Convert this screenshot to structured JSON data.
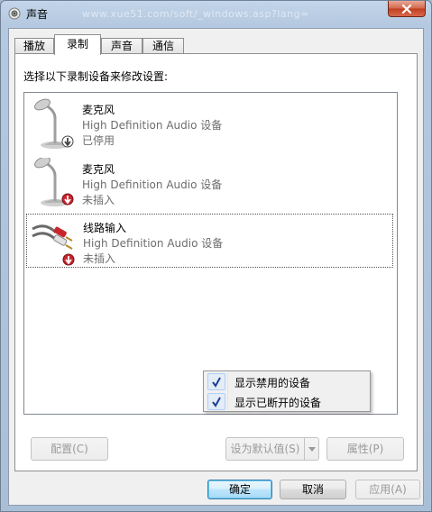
{
  "window": {
    "title": "声音",
    "watermark": "www.xue51.com/soft/_windows.asp?lang="
  },
  "tabs": [
    {
      "label": "播放",
      "active": false
    },
    {
      "label": "录制",
      "active": true
    },
    {
      "label": "声音",
      "active": false
    },
    {
      "label": "通信",
      "active": false
    }
  ],
  "instruction": "选择以下录制设备来修改设置:",
  "devices": [
    {
      "name": "麦克风",
      "description": "High Definition Audio 设备",
      "status": "已停用",
      "icon": "microphone-icon",
      "badge": "disabled-down-arrow"
    },
    {
      "name": "麦克风",
      "description": "High Definition Audio 设备",
      "status": "未插入",
      "icon": "microphone-icon",
      "badge": "unplugged-red-arrow"
    },
    {
      "name": "线路输入",
      "description": "High Definition Audio 设备",
      "status": "未插入",
      "icon": "line-in-cable-icon",
      "badge": "unplugged-red-arrow"
    }
  ],
  "context_menu": [
    {
      "label": "显示禁用的设备",
      "checked": true
    },
    {
      "label": "显示已断开的设备",
      "checked": true
    }
  ],
  "buttons": {
    "configure": "配置(C)",
    "set_default": "设为默认值(S)",
    "properties": "属性(P)",
    "ok": "确定",
    "cancel": "取消",
    "apply": "应用(A)"
  },
  "colors": {
    "check": "#1c3f94",
    "badge_red": "#c8252c",
    "badge_gray": "#444444"
  }
}
